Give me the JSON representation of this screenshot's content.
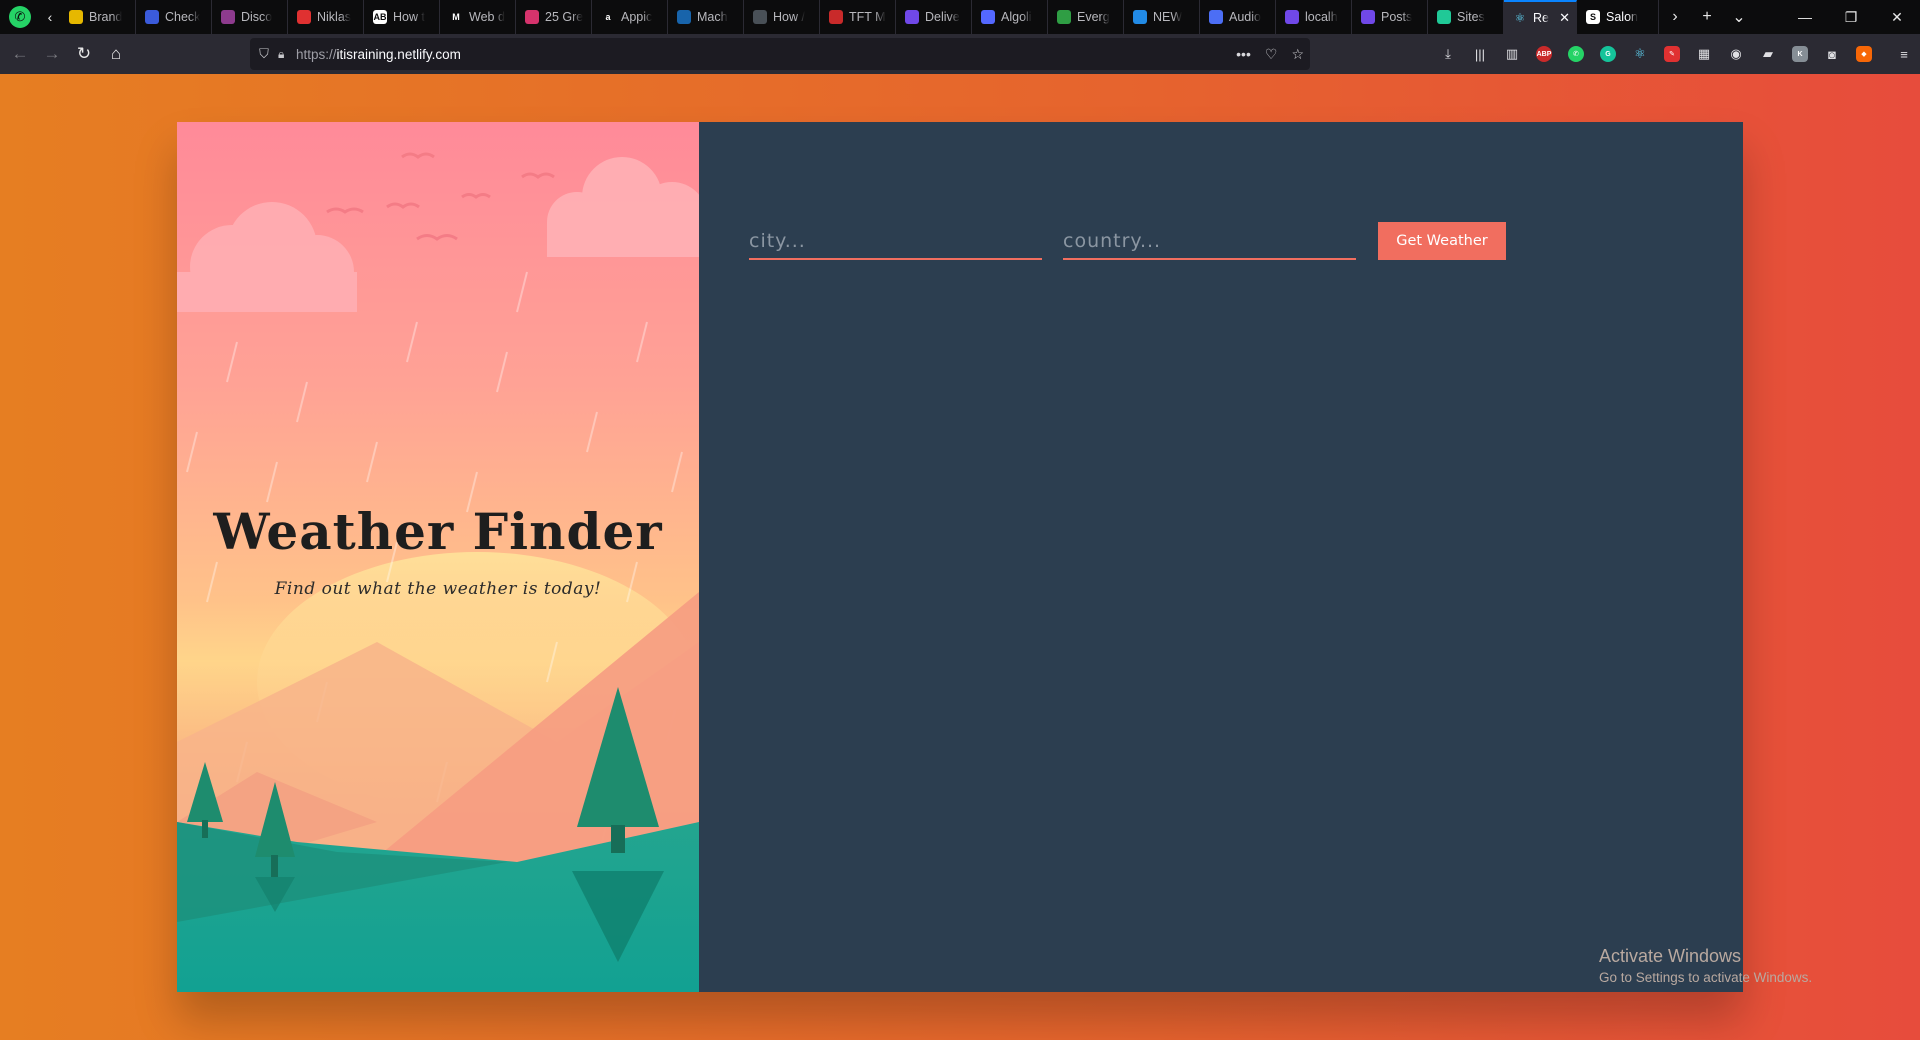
{
  "browser": {
    "tabs": [
      {
        "label": "Brand",
        "fav_color": "#e6b800",
        "fav_glyph": ""
      },
      {
        "label": "Check",
        "fav_color": "#3b5bdb",
        "fav_glyph": ""
      },
      {
        "label": "Disco",
        "fav_color": "#8e3b8e",
        "fav_glyph": ""
      },
      {
        "label": "Niklas",
        "fav_color": "#e03131",
        "fav_glyph": ""
      },
      {
        "label": "How t",
        "fav_color": "#ffffff",
        "fav_glyph": "AB"
      },
      {
        "label": "Web d",
        "fav_color": "#0c0c0d",
        "fav_glyph": "M"
      },
      {
        "label": "25 Gre",
        "fav_color": "#d6336c",
        "fav_glyph": ""
      },
      {
        "label": "Appic",
        "fav_color": "#0c0c0d",
        "fav_glyph": "a"
      },
      {
        "label": "Mach",
        "fav_color": "#1864ab",
        "fav_glyph": ""
      },
      {
        "label": "How /",
        "fav_color": "#495057",
        "fav_glyph": ""
      },
      {
        "label": "TFT M",
        "fav_color": "#c92a2a",
        "fav_glyph": ""
      },
      {
        "label": "Delive",
        "fav_color": "#7048e8",
        "fav_glyph": ""
      },
      {
        "label": "Algoli",
        "fav_color": "#5468ff",
        "fav_glyph": ""
      },
      {
        "label": "Everg",
        "fav_color": "#2f9e44",
        "fav_glyph": ""
      },
      {
        "label": "NEW",
        "fav_color": "#228be6",
        "fav_glyph": ""
      },
      {
        "label": "Audio",
        "fav_color": "#4c6ef5",
        "fav_glyph": ""
      },
      {
        "label": "localh",
        "fav_color": "#7048e8",
        "fav_glyph": ""
      },
      {
        "label": "Posts",
        "fav_color": "#7048e8",
        "fav_glyph": ""
      },
      {
        "label": "Sites",
        "fav_color": "#20c997",
        "fav_glyph": ""
      }
    ],
    "active_tab": {
      "label": "Re",
      "fav_color": "#61dafb"
    },
    "pinned_tab": {
      "label": "Salon",
      "fav_glyph": "S"
    },
    "url_protocol": "https://",
    "url_host": "itisraining.netlify.com"
  },
  "hero": {
    "title": "Weather Finder",
    "subtitle": "Find out what the weather is today!"
  },
  "form": {
    "city_placeholder": "city...",
    "country_placeholder": "country...",
    "button_label": "Get Weather"
  },
  "watermark": {
    "line1": "Activate Windows",
    "line2": "Go to Settings to activate Windows."
  }
}
